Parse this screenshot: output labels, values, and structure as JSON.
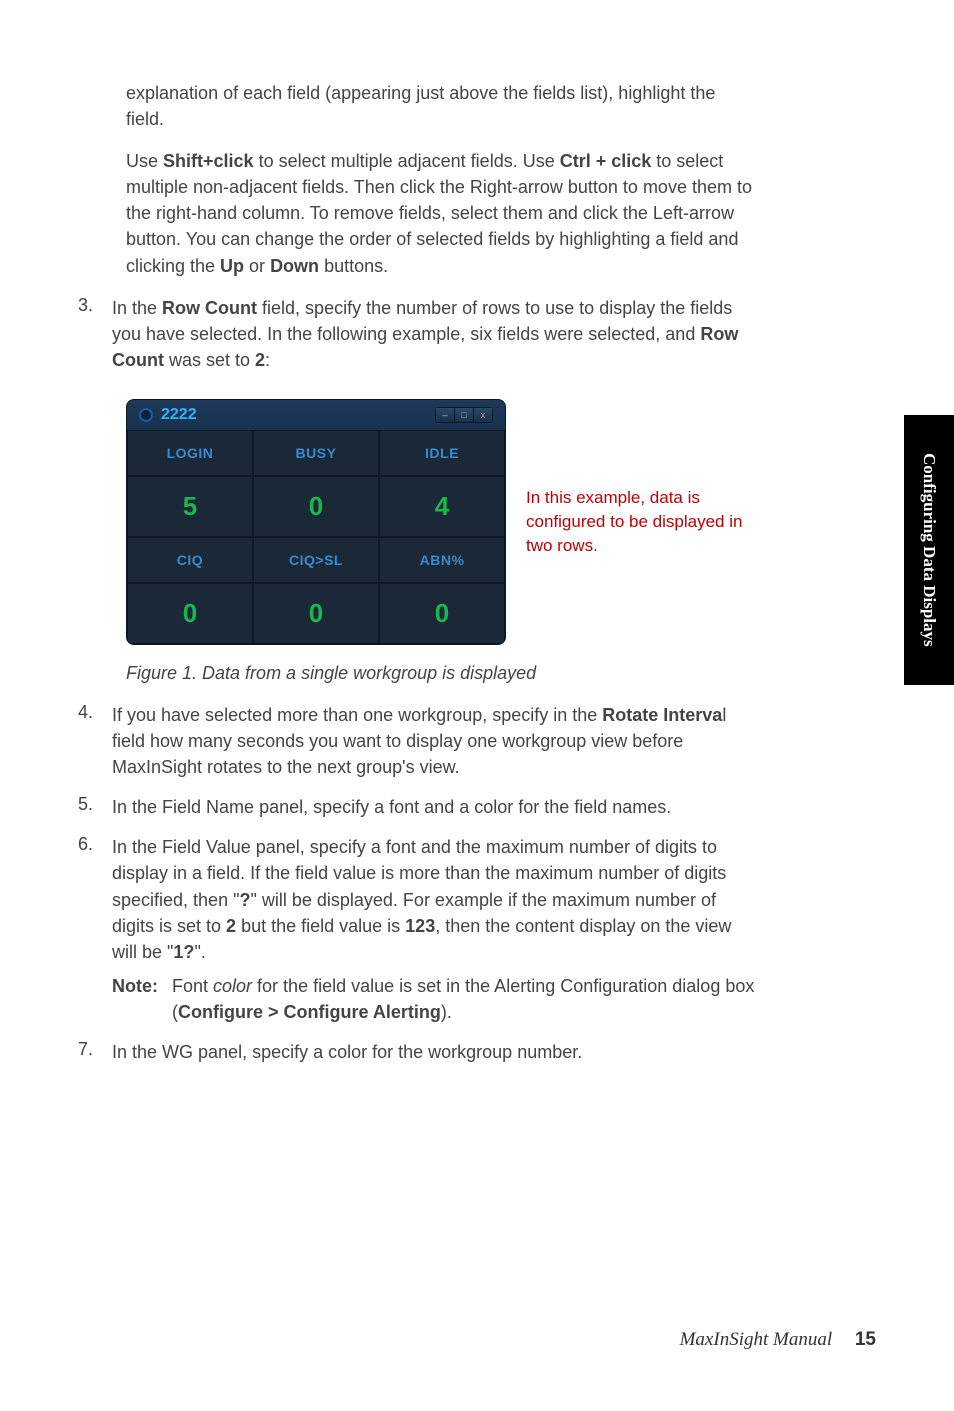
{
  "para_intro": "explanation of each field (appearing just above the fields list), highlight the field.",
  "para_shiftclick_pre": "Use ",
  "shift_click": "Shift+click",
  "para_shiftclick_mid1": " to select multiple adjacent fields. Use ",
  "ctrl_click": "Ctrl + click",
  "para_shiftclick_mid2": " to select multiple non-adjacent fields. Then click the Right-arrow button to move them to the right-hand column. To remove fields, select them and click the Left-arrow button. You can change the order of selected fields by highlighting a field and clicking the ",
  "up_btn": "Up",
  "or_word": " or ",
  "down_btn": "Down",
  "para_shiftclick_end": " buttons.",
  "item3_num": "3.",
  "item3_pre": "In the ",
  "row_count": "Row Count",
  "item3_mid": " field, specify the number of rows to use to display the fields you have selected. In the following example, six fields were selected, and ",
  "item3_was": " was set to ",
  "two": "2",
  "colon": ":",
  "dashboard": {
    "title": "2222",
    "win_min": "–",
    "win_max": "□",
    "win_close": "x",
    "cells": [
      {
        "label": "LOGIN",
        "value": "5"
      },
      {
        "label": "BUSY",
        "value": "0"
      },
      {
        "label": "IDLE",
        "value": "4"
      },
      {
        "label": "CIQ",
        "value": "0"
      },
      {
        "label": "CIQ>SL",
        "value": "0"
      },
      {
        "label": "ABN%",
        "value": "0"
      }
    ]
  },
  "fig_note": "In this example, data is configured to be displayed in two rows.",
  "fig_caption": "Figure 1.   Data from a single workgroup is displayed",
  "item4_num": "4.",
  "item4_pre": "If you have selected more than one workgroup, specify in the ",
  "rotate_interval": "Rotate Interva",
  "item4_l": "l",
  "item4_post": " field how many seconds you want to display one workgroup view before MaxInSight rotates to the next group's view.",
  "item5_num": "5.",
  "item5_text": "In the Field Name panel, specify a font and a color for the field names.",
  "item6_num": "6.",
  "item6_pre": "In the Field Value panel, specify a font and the maximum number of digits to display in a field. If the field value is more than the maximum number of digits specified, then \"",
  "qmark": "?",
  "item6_mid1": "\" will be displayed. For example if the maximum number of digits is set to ",
  "item6_mid2": " but the field value is ",
  "v123": "123",
  "item6_mid3": ", then the content display on the view will be \"",
  "v1q": "1?",
  "item6_end": "\".",
  "note_label": "Note:",
  "note_pre": "Font ",
  "color_word": "color",
  "note_mid": " for the field value is set in the Alerting Configuration dialog box (",
  "configure_path": "Configure > Configure Alerting",
  "note_end": ").",
  "item7_num": "7.",
  "item7_text": "In the WG panel, specify a color for the workgroup number.",
  "side_tab": "Configuring Data Displays",
  "footer_title": "MaxInSight Manual",
  "footer_page": "15"
}
